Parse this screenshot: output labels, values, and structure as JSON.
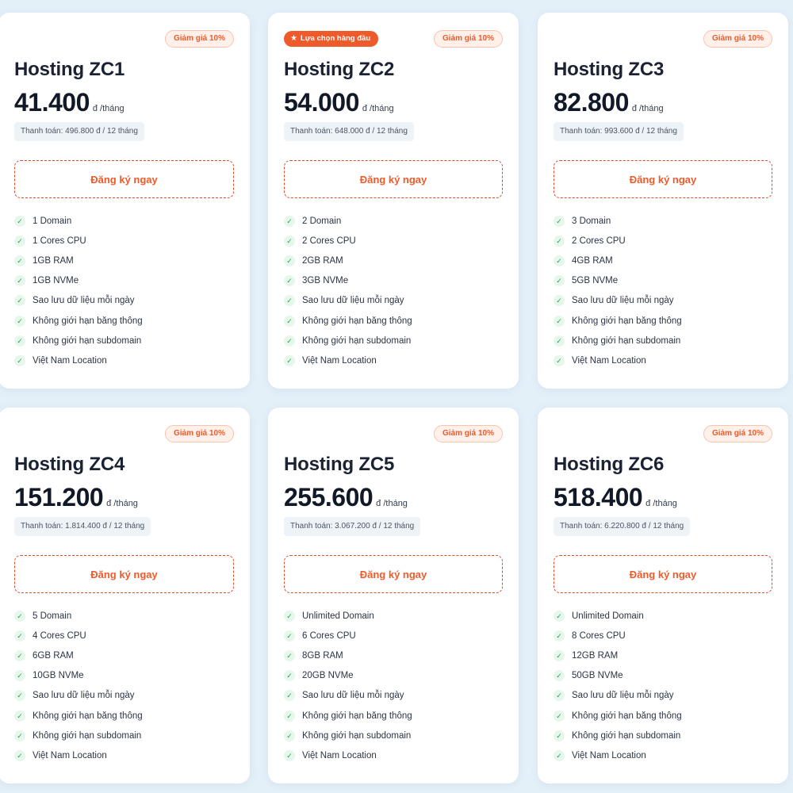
{
  "colors": {
    "accent": "#ef5a2b",
    "background": "#e4f0f8",
    "check": "#22a55a"
  },
  "cards": [
    {
      "top_badge": "",
      "discount": "Giảm giá 10%",
      "name": "Hosting ZC1",
      "price": "41.400",
      "unit": "đ /tháng",
      "billing": "Thanh toán: 496.800 đ / 12 tháng",
      "button": "Đăng ký ngay",
      "features": [
        "1 Domain",
        "1 Cores CPU",
        "1GB RAM",
        "1GB NVMe",
        "Sao lưu dữ liệu mỗi ngày",
        "Không giới hạn băng thông",
        "Không giới hạn subdomain",
        "Việt Nam Location"
      ]
    },
    {
      "top_badge": "Lựa chọn hàng đầu",
      "discount": "Giảm giá 10%",
      "name": "Hosting ZC2",
      "price": "54.000",
      "unit": "đ /tháng",
      "billing": "Thanh toán: 648.000 đ / 12 tháng",
      "button": "Đăng ký ngay",
      "features": [
        "2 Domain",
        "2 Cores CPU",
        "2GB RAM",
        "3GB NVMe",
        "Sao lưu dữ liệu mỗi ngày",
        "Không giới hạn băng thông",
        "Không giới hạn subdomain",
        "Việt Nam Location"
      ]
    },
    {
      "top_badge": "",
      "discount": "Giảm giá 10%",
      "name": "Hosting ZC3",
      "price": "82.800",
      "unit": "đ /tháng",
      "billing": "Thanh toán: 993.600 đ / 12 tháng",
      "button": "Đăng ký ngay",
      "features": [
        "3 Domain",
        "2 Cores CPU",
        "4GB RAM",
        "5GB NVMe",
        "Sao lưu dữ liệu mỗi ngày",
        "Không giới hạn băng thông",
        "Không giới hạn subdomain",
        "Việt Nam Location"
      ]
    },
    {
      "top_badge": "",
      "discount": "Giảm giá 10%",
      "name": "Hosting ZC4",
      "price": "151.200",
      "unit": "đ /tháng",
      "billing": "Thanh toán: 1.814.400 đ / 12 tháng",
      "button": "Đăng ký ngay",
      "features": [
        "5 Domain",
        "4 Cores CPU",
        "6GB RAM",
        "10GB NVMe",
        "Sao lưu dữ liệu mỗi ngày",
        "Không giới hạn băng thông",
        "Không giới hạn subdomain",
        "Việt Nam Location"
      ]
    },
    {
      "top_badge": "",
      "discount": "Giảm giá 10%",
      "name": "Hosting ZC5",
      "price": "255.600",
      "unit": "đ /tháng",
      "billing": "Thanh toán: 3.067.200 đ / 12 tháng",
      "button": "Đăng ký ngay",
      "features": [
        "Unlimited Domain",
        "6 Cores CPU",
        "8GB RAM",
        "20GB NVMe",
        "Sao lưu dữ liệu mỗi ngày",
        "Không giới hạn băng thông",
        "Không giới hạn subdomain",
        "Việt Nam Location"
      ]
    },
    {
      "top_badge": "",
      "discount": "Giảm giá 10%",
      "name": "Hosting ZC6",
      "price": "518.400",
      "unit": "đ /tháng",
      "billing": "Thanh toán: 6.220.800 đ / 12 tháng",
      "button": "Đăng ký ngay",
      "features": [
        "Unlimited Domain",
        "8 Cores CPU",
        "12GB RAM",
        "50GB NVMe",
        "Sao lưu dữ liệu mỗi ngày",
        "Không giới hạn băng thông",
        "Không giới hạn subdomain",
        "Việt Nam Location"
      ]
    }
  ]
}
